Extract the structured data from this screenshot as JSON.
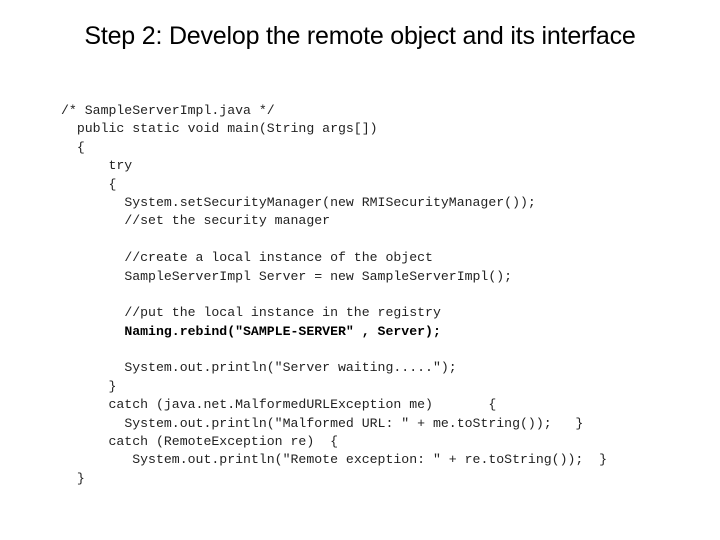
{
  "slide": {
    "title": "Step 2: Develop the remote object and its interface"
  },
  "code": {
    "lines": [
      {
        "text": "/* SampleServerImpl.java */",
        "indent": "",
        "bold": false
      },
      {
        "text": "public static void main(String args[])",
        "indent": "  ",
        "bold": false
      },
      {
        "text": "{",
        "indent": "  ",
        "bold": false
      },
      {
        "text": "try",
        "indent": "      ",
        "bold": false
      },
      {
        "text": "{",
        "indent": "      ",
        "bold": false
      },
      {
        "text": "System.setSecurityManager(new RMISecurityManager());",
        "indent": "        ",
        "bold": false
      },
      {
        "text": "//set the security manager",
        "indent": "        ",
        "bold": false
      },
      {
        "text": "",
        "indent": "",
        "bold": false
      },
      {
        "text": "//create a local instance of the object",
        "indent": "        ",
        "bold": false
      },
      {
        "text": "SampleServerImpl Server = new SampleServerImpl();",
        "indent": "        ",
        "bold": false
      },
      {
        "text": "",
        "indent": "",
        "bold": false
      },
      {
        "text": "//put the local instance in the registry",
        "indent": "        ",
        "bold": false
      },
      {
        "text": "Naming.rebind(\"SAMPLE-SERVER\" , Server);",
        "indent": "        ",
        "bold": true
      },
      {
        "text": "",
        "indent": "",
        "bold": false
      },
      {
        "text": "System.out.println(\"Server waiting.....\");",
        "indent": "        ",
        "bold": false
      },
      {
        "text": "}",
        "indent": "      ",
        "bold": false
      },
      {
        "text": "catch (java.net.MalformedURLException me)       {",
        "indent": "      ",
        "bold": false
      },
      {
        "text": "System.out.println(\"Malformed URL: \" + me.toString());   }",
        "indent": "        ",
        "bold": false
      },
      {
        "text": "catch (RemoteException re)  {",
        "indent": "      ",
        "bold": false
      },
      {
        "text": "System.out.println(\"Remote exception: \" + re.toString());  }",
        "indent": "         ",
        "bold": false
      },
      {
        "text": "}",
        "indent": "  ",
        "bold": false
      }
    ]
  }
}
